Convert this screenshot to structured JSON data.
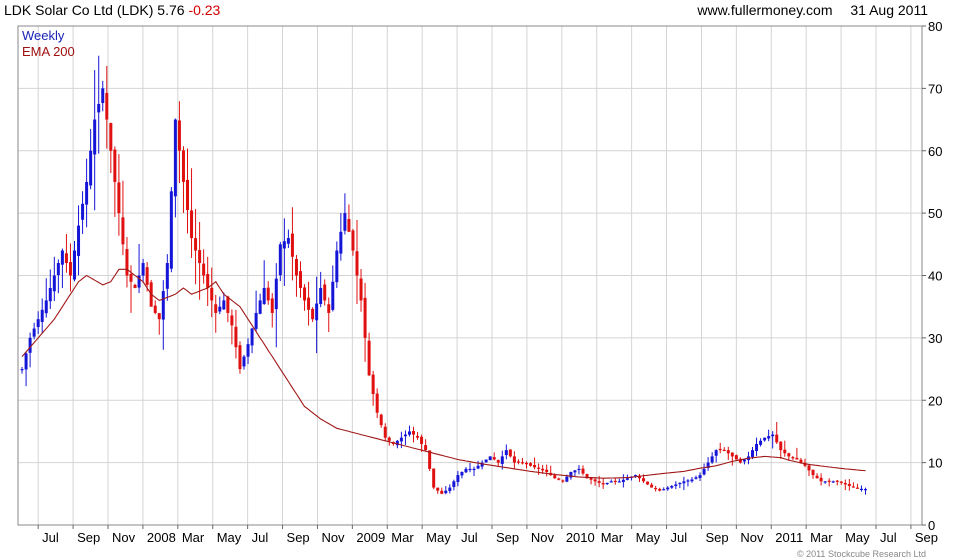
{
  "header": {
    "symbol_text": "LDK Solar Co Ltd (LDK)",
    "last_price": "5.76",
    "change": "-0.23",
    "site": "www.fullermoney.com",
    "date": "31 Aug 2011"
  },
  "legend": {
    "weekly": "Weekly",
    "ema": "EMA 200"
  },
  "copyright": "© 2011 Stockcube Research Ltd",
  "colors": {
    "up": "#1515d8",
    "down": "#e01010",
    "ema": "#a01818",
    "grid": "#d4d4d4"
  },
  "chart_data": {
    "type": "candlestick",
    "title": "LDK Solar Co Ltd (LDK)",
    "interval": "Weekly",
    "y_axis": {
      "side": "right",
      "ylim": [
        0,
        80
      ],
      "ticks": [
        0,
        10,
        20,
        30,
        40,
        50,
        60,
        70,
        80
      ]
    },
    "x_axis": {
      "start_week": -5,
      "end_week": 219,
      "tick_labels": [
        "Jul",
        "Sep",
        "Nov",
        "2008",
        "Mar",
        "May",
        "Jul",
        "Sep",
        "Nov",
        "2009",
        "Mar",
        "May",
        "Jul",
        "Sep",
        "Nov",
        "2010",
        "Mar",
        "May",
        "Jul",
        "Sep",
        "Nov",
        "2011",
        "Mar",
        "May",
        "Jul",
        "Sep"
      ]
    },
    "grid": true,
    "legend_position": "top-left",
    "series": [
      {
        "name": "Weekly",
        "kind": "candles",
        "note": "blue = up week, red = down week"
      },
      {
        "name": "EMA 200",
        "kind": "line",
        "color": "#a01818"
      }
    ],
    "close_anchors": [
      [
        -4,
        25
      ],
      [
        -2,
        30
      ],
      [
        0,
        33
      ],
      [
        2,
        36
      ],
      [
        4,
        40
      ],
      [
        6,
        44
      ],
      [
        8,
        40
      ],
      [
        10,
        48
      ],
      [
        12,
        55
      ],
      [
        14,
        65
      ],
      [
        16,
        70
      ],
      [
        18,
        60
      ],
      [
        20,
        50
      ],
      [
        22,
        40
      ],
      [
        24,
        38
      ],
      [
        26,
        42
      ],
      [
        28,
        35
      ],
      [
        30,
        33
      ],
      [
        32,
        42
      ],
      [
        34,
        65
      ],
      [
        36,
        55
      ],
      [
        38,
        46
      ],
      [
        40,
        42
      ],
      [
        42,
        38
      ],
      [
        44,
        34
      ],
      [
        46,
        36
      ],
      [
        48,
        32
      ],
      [
        50,
        25
      ],
      [
        52,
        29
      ],
      [
        54,
        34
      ],
      [
        56,
        38
      ],
      [
        58,
        34
      ],
      [
        60,
        45
      ],
      [
        62,
        46
      ],
      [
        64,
        40
      ],
      [
        66,
        36
      ],
      [
        68,
        33
      ],
      [
        70,
        38
      ],
      [
        72,
        34
      ],
      [
        74,
        44
      ],
      [
        76,
        50
      ],
      [
        78,
        44
      ],
      [
        80,
        36
      ],
      [
        82,
        24
      ],
      [
        84,
        18
      ],
      [
        86,
        14
      ],
      [
        88,
        13
      ],
      [
        90,
        14
      ],
      [
        92,
        15
      ],
      [
        94,
        14
      ],
      [
        96,
        12
      ],
      [
        98,
        6
      ],
      [
        100,
        5
      ],
      [
        102,
        6
      ],
      [
        104,
        8
      ],
      [
        106,
        9
      ],
      [
        108,
        9
      ],
      [
        110,
        10
      ],
      [
        112,
        11
      ],
      [
        114,
        10
      ],
      [
        116,
        12
      ],
      [
        118,
        10
      ],
      [
        120,
        10
      ],
      [
        122,
        9.5
      ],
      [
        124,
        9
      ],
      [
        126,
        8.5
      ],
      [
        128,
        7.5
      ],
      [
        130,
        7
      ],
      [
        132,
        8.5
      ],
      [
        134,
        9
      ],
      [
        136,
        7.5
      ],
      [
        138,
        7
      ],
      [
        140,
        6.5
      ],
      [
        142,
        7
      ],
      [
        144,
        7
      ],
      [
        146,
        7.5
      ],
      [
        148,
        8
      ],
      [
        150,
        7
      ],
      [
        152,
        6
      ],
      [
        154,
        5.5
      ],
      [
        156,
        6
      ],
      [
        158,
        6.5
      ],
      [
        160,
        7
      ],
      [
        162,
        7.3
      ],
      [
        164,
        8
      ],
      [
        166,
        10
      ],
      [
        168,
        12
      ],
      [
        170,
        12
      ],
      [
        172,
        11
      ],
      [
        174,
        10
      ],
      [
        176,
        11
      ],
      [
        178,
        13
      ],
      [
        180,
        14
      ],
      [
        182,
        14.5
      ],
      [
        184,
        12
      ],
      [
        186,
        11
      ],
      [
        188,
        10.5
      ],
      [
        190,
        9.5
      ],
      [
        192,
        8
      ],
      [
        194,
        7
      ],
      [
        196,
        7
      ],
      [
        198,
        7
      ],
      [
        200,
        6.5
      ],
      [
        202,
        6
      ],
      [
        204,
        5.8
      ],
      [
        205,
        5.76
      ]
    ],
    "ema_anchors": [
      [
        -4,
        27
      ],
      [
        0,
        30
      ],
      [
        4,
        33
      ],
      [
        8,
        37
      ],
      [
        10,
        39
      ],
      [
        12,
        40
      ],
      [
        16,
        38.5
      ],
      [
        18,
        39
      ],
      [
        20,
        41
      ],
      [
        22,
        41
      ],
      [
        26,
        39
      ],
      [
        28,
        37
      ],
      [
        30,
        36
      ],
      [
        34,
        37
      ],
      [
        36,
        38
      ],
      [
        38,
        37
      ],
      [
        42,
        38
      ],
      [
        44,
        39
      ],
      [
        46,
        37
      ],
      [
        50,
        35
      ],
      [
        54,
        31
      ],
      [
        58,
        27
      ],
      [
        62,
        23
      ],
      [
        66,
        19
      ],
      [
        70,
        17
      ],
      [
        74,
        15.5
      ],
      [
        80,
        14.5
      ],
      [
        86,
        13.5
      ],
      [
        92,
        12.5
      ],
      [
        98,
        11.5
      ],
      [
        104,
        10.5
      ],
      [
        110,
        9.8
      ],
      [
        116,
        9.2
      ],
      [
        122,
        8.6
      ],
      [
        128,
        8.1
      ],
      [
        134,
        7.7
      ],
      [
        140,
        7.5
      ],
      [
        146,
        7.6
      ],
      [
        150,
        7.9
      ],
      [
        154,
        8.2
      ],
      [
        160,
        8.6
      ],
      [
        164,
        9.1
      ],
      [
        168,
        9.5
      ],
      [
        172,
        10.2
      ],
      [
        176,
        10.7
      ],
      [
        180,
        11
      ],
      [
        184,
        10.8
      ],
      [
        186,
        10.4
      ],
      [
        190,
        9.8
      ],
      [
        196,
        9.3
      ],
      [
        200,
        9
      ],
      [
        205,
        8.7
      ]
    ]
  }
}
